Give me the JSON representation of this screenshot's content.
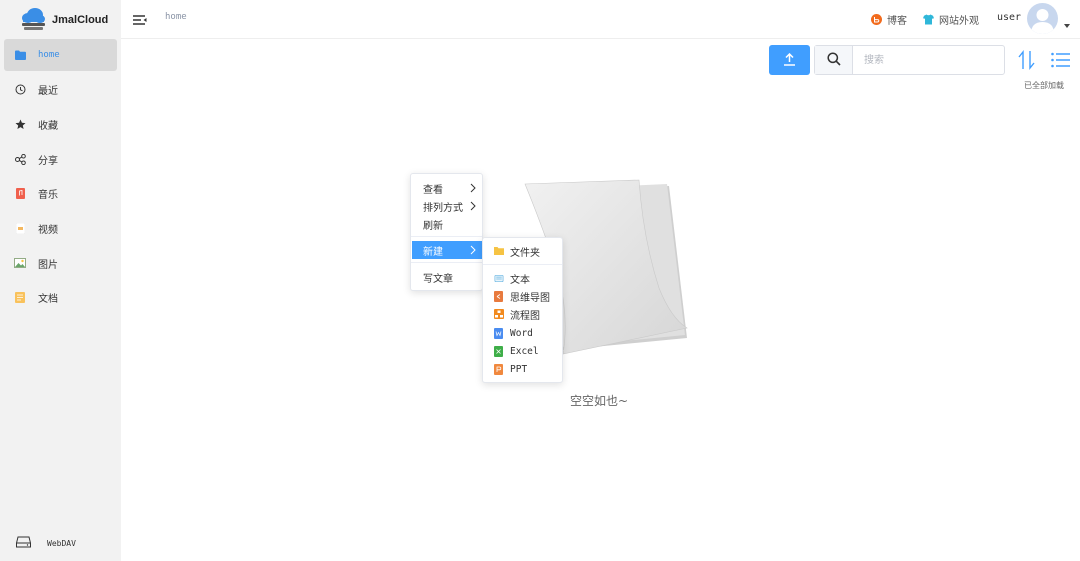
{
  "app": {
    "name": "JmalCloud"
  },
  "sidebar": {
    "items": [
      {
        "label": "home",
        "icon": "folder-icon",
        "active": true
      },
      {
        "label": "最近",
        "icon": "clock-icon"
      },
      {
        "label": "收藏",
        "icon": "star-icon"
      },
      {
        "label": "分享",
        "icon": "share-icon"
      },
      {
        "label": "音乐",
        "icon": "music-file-icon"
      },
      {
        "label": "视频",
        "icon": "video-file-icon"
      },
      {
        "label": "图片",
        "icon": "image-icon"
      },
      {
        "label": "文档",
        "icon": "document-icon"
      }
    ],
    "webdav": {
      "label": "WebDAV",
      "icon": "drive-icon"
    }
  },
  "header": {
    "breadcrumb": "home",
    "blog": {
      "label": "博客",
      "icon": "blog-icon"
    },
    "appearance": {
      "label": "网站外观",
      "icon": "tshirt-icon"
    },
    "username": "user"
  },
  "toolbar": {
    "search_placeholder": "搜索",
    "load_status": "已全部加载"
  },
  "empty": {
    "text": "空空如也~"
  },
  "context_menu": {
    "items": [
      {
        "label": "查看",
        "has_submenu": true
      },
      {
        "label": "排列方式",
        "has_submenu": true
      },
      {
        "label": "刷新",
        "has_submenu": false
      },
      {
        "label": "新建",
        "has_submenu": true,
        "active": true
      },
      {
        "label": "写文章",
        "has_submenu": false
      }
    ]
  },
  "new_submenu": {
    "items": [
      {
        "label": "文件夹",
        "icon": "folder-icon"
      },
      {
        "label": "文本",
        "icon": "text-file-icon"
      },
      {
        "label": "思维导图",
        "icon": "mindmap-icon"
      },
      {
        "label": "流程图",
        "icon": "flowchart-icon"
      },
      {
        "label": "Word",
        "icon": "word-icon"
      },
      {
        "label": "Excel",
        "icon": "excel-icon"
      },
      {
        "label": "PPT",
        "icon": "ppt-icon"
      }
    ]
  },
  "colors": {
    "accent": "#409eff",
    "active_text": "#3a8ee6",
    "sidebar_bg": "#f2f2f2"
  }
}
